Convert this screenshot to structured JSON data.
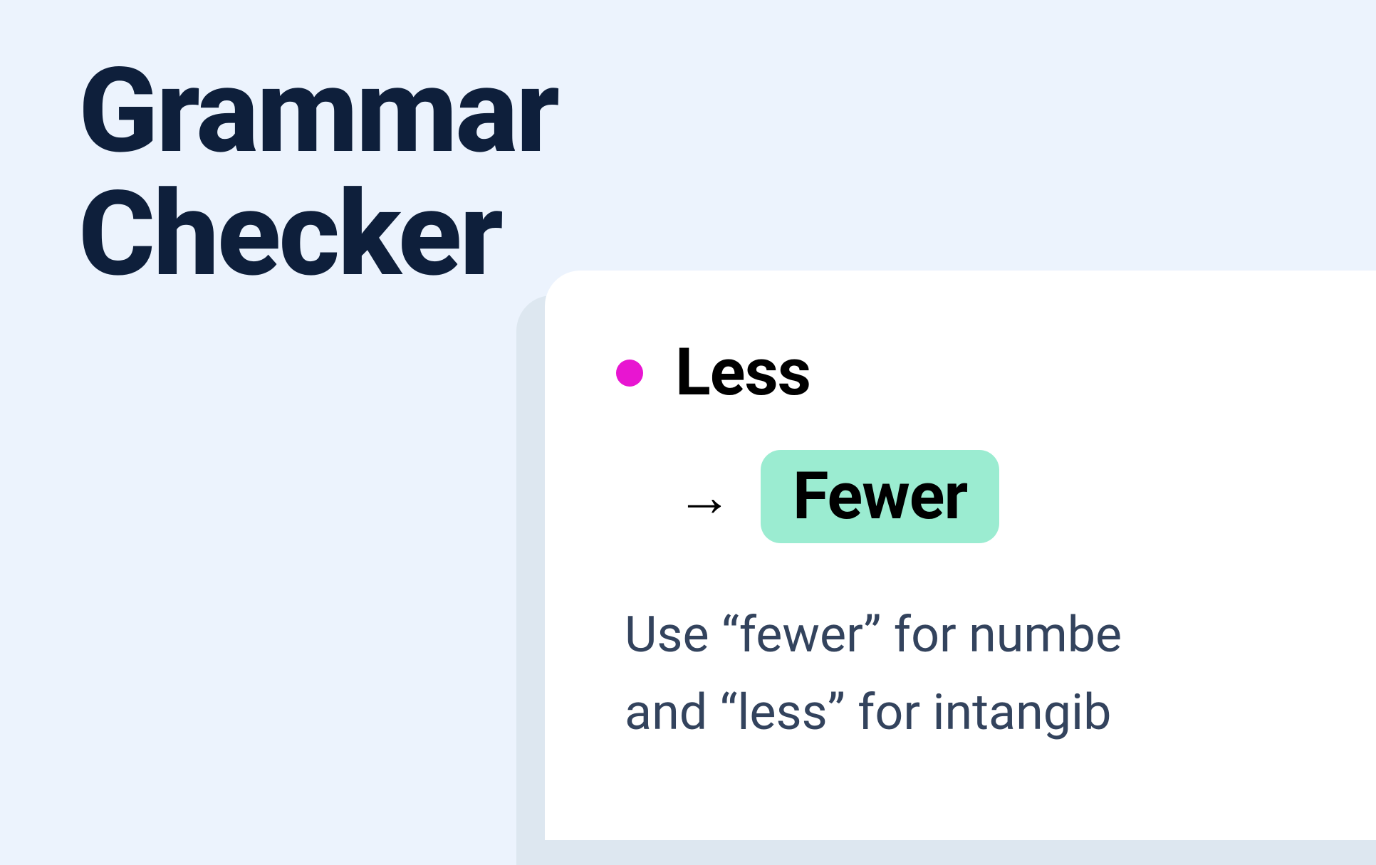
{
  "header": {
    "title_line1": "Grammar",
    "title_line2": "Checker"
  },
  "suggestion": {
    "original_word": "Less",
    "suggested_word": "Fewer",
    "explanation_line1": "Use “fewer” for numbe",
    "explanation_line2": "and “less” for intangib"
  },
  "colors": {
    "background": "#ecf3fd",
    "title_text": "#0e1f3b",
    "dot": "#e815d1",
    "highlight": "#9becd1",
    "explanation_text": "#33435d"
  }
}
